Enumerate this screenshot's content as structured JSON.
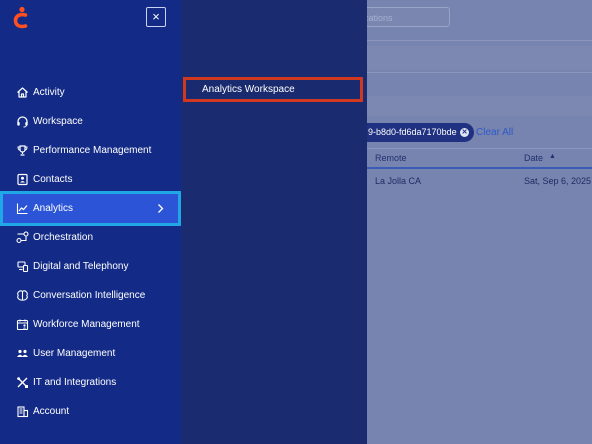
{
  "background": {
    "search_placeholder": "ocations",
    "filter_chip": "9-b8d0-fd6da7170bde",
    "clear_all": "Clear All",
    "table": {
      "headers": [
        "Remote",
        "Date"
      ],
      "row": [
        "La Jolla CA",
        "Sat, Sep 6, 2025"
      ]
    }
  },
  "sidebar": {
    "close_label": "×",
    "items": [
      {
        "label": "Activity",
        "icon": "home-icon"
      },
      {
        "label": "Workspace",
        "icon": "headset-icon"
      },
      {
        "label": "Performance Management",
        "icon": "trophy-icon"
      },
      {
        "label": "Contacts",
        "icon": "contact-card-icon"
      },
      {
        "label": "Analytics",
        "icon": "line-chart-icon",
        "active": true
      },
      {
        "label": "Orchestration",
        "icon": "flow-icon"
      },
      {
        "label": "Digital and Telephony",
        "icon": "devices-icon"
      },
      {
        "label": "Conversation Intelligence",
        "icon": "brain-icon"
      },
      {
        "label": "Workforce Management",
        "icon": "calendar-people-icon"
      },
      {
        "label": "User Management",
        "icon": "users-icon"
      },
      {
        "label": "IT and Integrations",
        "icon": "tools-icon"
      },
      {
        "label": "Account",
        "icon": "building-icon"
      }
    ]
  },
  "submenu": {
    "items": [
      {
        "label": "Analytics Workspace"
      }
    ]
  },
  "colors": {
    "sidebar_bg": "#132b87",
    "submenu_bg": "#1b2b70",
    "active_item": "#2b54d6",
    "active_outline": "#1fa7e6",
    "highlight_outline": "#d0391f",
    "brand_logo": "#ff4f1f"
  }
}
